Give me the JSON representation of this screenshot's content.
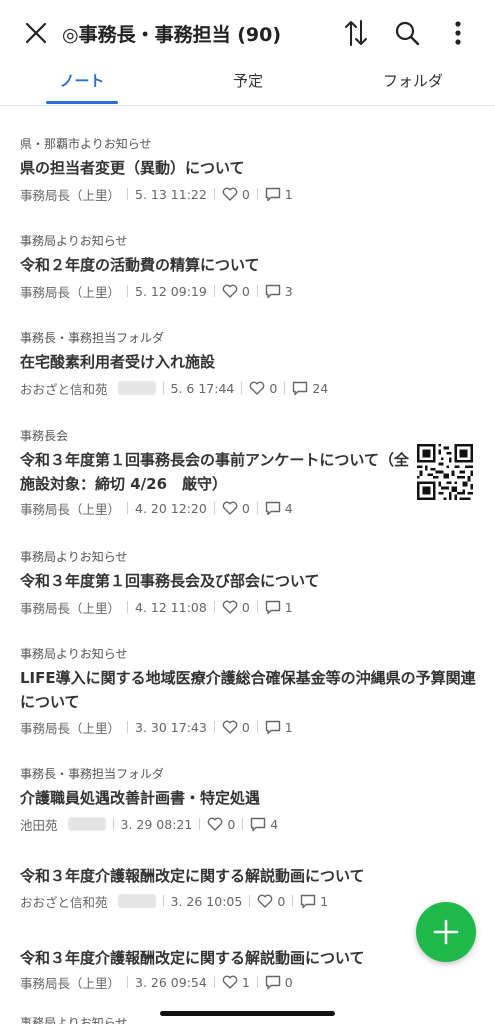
{
  "header": {
    "title": "◎事務長・事務担当 (90)",
    "icons": [
      "close-icon",
      "sort-icon",
      "search-icon",
      "more-icon"
    ]
  },
  "tabs": [
    {
      "label": "ノート",
      "active": true
    },
    {
      "label": "予定",
      "active": false
    },
    {
      "label": "フォルダ",
      "active": false
    }
  ],
  "notes": [
    {
      "folder": "県・那覇市よりお知らせ",
      "title": "県の担当者変更（異動）について",
      "author": "事務局長（上里）",
      "date": "5. 13 11:22",
      "likes": "0",
      "comments": "1"
    },
    {
      "folder": "事務局よりお知らせ",
      "title": "令和２年度の活動費の精算について",
      "author": "事務局長（上里）",
      "date": "5. 12 09:19",
      "likes": "0",
      "comments": "3"
    },
    {
      "folder": "事務長・事務担当フォルダ",
      "title": "在宅酸素利用者受け入れ施設",
      "author": "おおざと信和苑",
      "date": "5. 6 17:44",
      "likes": "0",
      "comments": "24"
    },
    {
      "folder": "事務長会",
      "title": "令和３年度第１回事務長会の事前アンケートについて（全施設対象：締切 4/26　厳守）",
      "author": "事務局長（上里）",
      "date": "4. 20 12:20",
      "likes": "0",
      "comments": "4"
    },
    {
      "folder": "事務局よりお知らせ",
      "title": "令和３年度第１回事務長会及び部会について",
      "author": "事務局長（上里）",
      "date": "4. 12 11:08",
      "likes": "0",
      "comments": "1"
    },
    {
      "folder": "事務局よりお知らせ",
      "title": "LIFE導入に関する地域医療介護総合確保基金等の沖縄県の予算関連について",
      "author": "事務局長（上里）",
      "date": "3. 30 17:43",
      "likes": "0",
      "comments": "1"
    },
    {
      "folder": "事務長・事務担当フォルダ",
      "title": "介護職員処遇改善計画書・特定処遇",
      "author": "池田苑",
      "date": "3. 29 08:21",
      "likes": "0",
      "comments": "4"
    },
    {
      "folder": "",
      "title": "令和３年度介護報酬改定に関する解説動画について",
      "author": "おおざと信和苑",
      "date": "3. 26 10:05",
      "likes": "0",
      "comments": "1"
    },
    {
      "folder": "",
      "title": "令和３年度介護報酬改定に関する解説動画について",
      "author": "事務局長（上里）",
      "date": "3. 26 09:54",
      "likes": "1",
      "comments": "0"
    },
    {
      "folder": "事務局よりお知らせ",
      "title": "",
      "author": "",
      "date": "",
      "likes": "",
      "comments": ""
    }
  ],
  "fab": {
    "icon": "plus-icon",
    "color": "#1fb84b"
  },
  "colors": {
    "accent": "#2b6fd6",
    "fab": "#1fb84b"
  }
}
